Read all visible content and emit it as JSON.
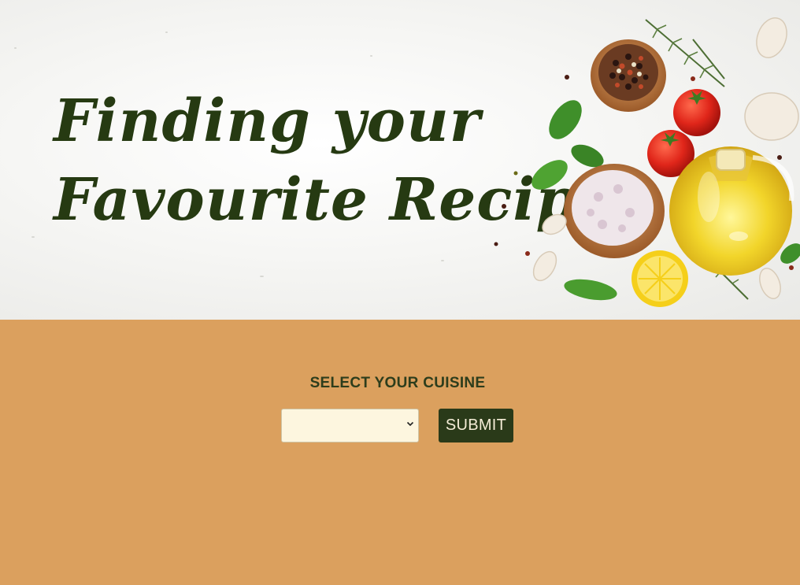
{
  "hero": {
    "title_line1": "Finding your",
    "title_line2": "Favourite Recipe",
    "image_content": [
      "pepper-bowl",
      "rosemary",
      "cherry-tomatoes",
      "basil-leaves",
      "salt-bowl",
      "olive-oil-bottle",
      "garlic",
      "lemon-half"
    ]
  },
  "form": {
    "label": "SELECT YOUR CUISINE",
    "select_value": "",
    "submit_label": "SUBMIT"
  },
  "colors": {
    "page_background": "#dba05e",
    "title_text": "#263a12",
    "button_background": "#2a3a19",
    "button_text": "#f4ecd6",
    "select_background": "#fdf6df"
  }
}
